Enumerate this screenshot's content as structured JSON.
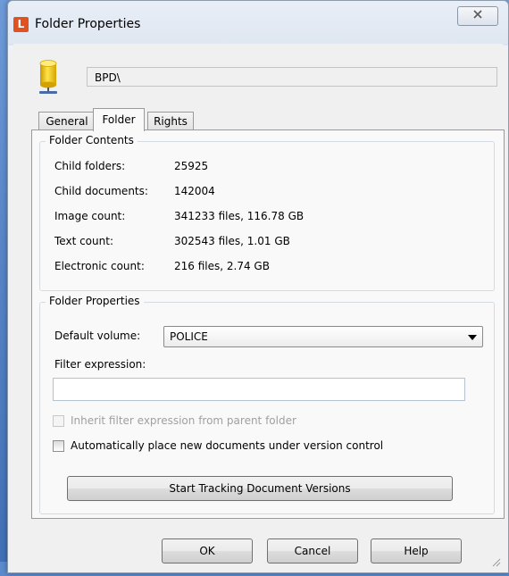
{
  "window": {
    "title": "Folder Properties",
    "app_icon_letter": "L",
    "close_glyph": "☒"
  },
  "folder": {
    "path": "BPD\\",
    "icon": "database-icon"
  },
  "tabs": [
    {
      "label": "General",
      "active": false
    },
    {
      "label": "Folder",
      "active": true
    },
    {
      "label": "Rights",
      "active": false
    }
  ],
  "folder_contents": {
    "legend": "Folder Contents",
    "rows": [
      {
        "label": "Child folders:",
        "value": "25925"
      },
      {
        "label": "Child documents:",
        "value": "142004"
      },
      {
        "label": "Image count:",
        "value": "341233 files, 116.78 GB"
      },
      {
        "label": "Text count:",
        "value": "302543 files, 1.01 GB"
      },
      {
        "label": "Electronic count:",
        "value": "216 files, 2.74 GB"
      }
    ]
  },
  "folder_properties": {
    "legend": "Folder Properties",
    "default_volume_label": "Default volume:",
    "default_volume_value": "POLICE",
    "filter_expression_label": "Filter expression:",
    "filter_expression_value": "",
    "inherit_label": "Inherit filter expression from parent folder",
    "inherit_checked": false,
    "inherit_enabled": false,
    "auto_version_label": "Automatically place new documents under version control",
    "auto_version_checked": false,
    "tracking_button": "Start Tracking Document Versions"
  },
  "buttons": {
    "ok": "OK",
    "cancel": "Cancel",
    "help": "Help"
  },
  "colors": {
    "app_icon": "#e0521f",
    "desktop": "#4d7fc2"
  }
}
